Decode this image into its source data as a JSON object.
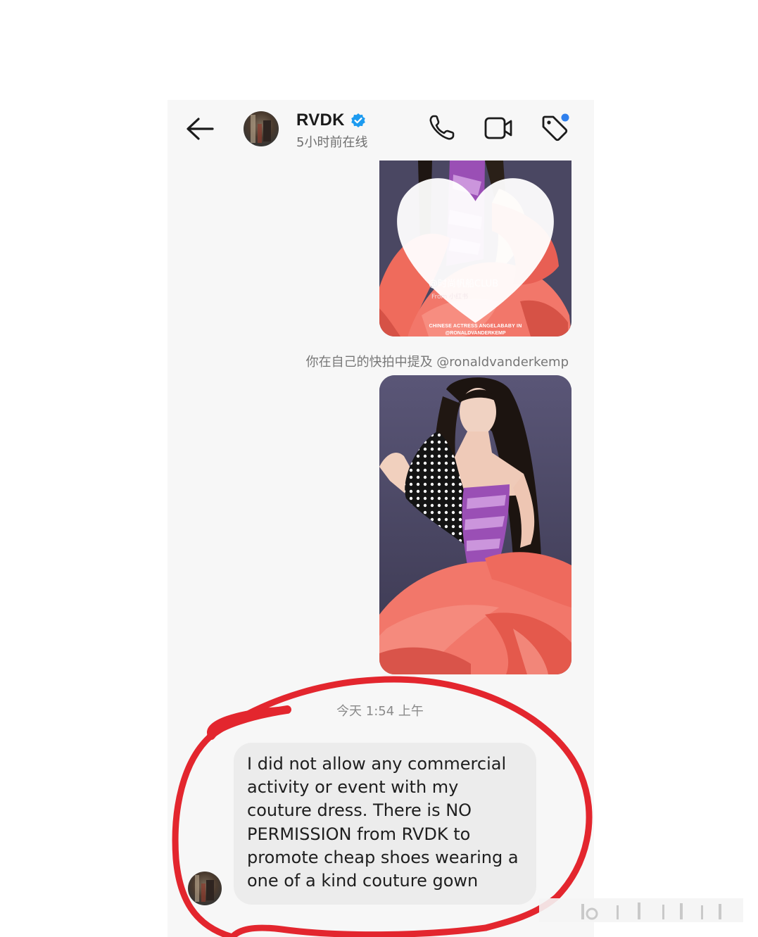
{
  "header": {
    "name": "RVDK",
    "status": "5小时前在线",
    "icons": {
      "back": "back-arrow-icon",
      "verified": "verified-badge-icon",
      "phone": "phone-icon",
      "video": "video-call-icon",
      "tag": "tag-icon"
    },
    "colors": {
      "verified": "#1d9bf0",
      "tag_dot": "#2f80ed"
    }
  },
  "messages": {
    "photo1": {
      "watermark": "@时尚帆船CLUB",
      "watermark_sub": "From 小红书",
      "caption_line1": "CHINESE ACTRESS ANGELABABY IN",
      "caption_line2": "@RONALDVANDERKEMP"
    },
    "mention_note": "你在自己的快拍中提及 @ronaldvanderkemp",
    "timestamp": "今天 1:54 上午",
    "text_message": {
      "lines": [
        "I did not allow any commercial",
        "activity or event with my",
        "couture dress. There is NO",
        "PERMISSION from RVDK to",
        "promote cheap shoes wearing a",
        "one of a kind couture gown"
      ]
    }
  },
  "annotation": {
    "color": "#e3262e"
  }
}
